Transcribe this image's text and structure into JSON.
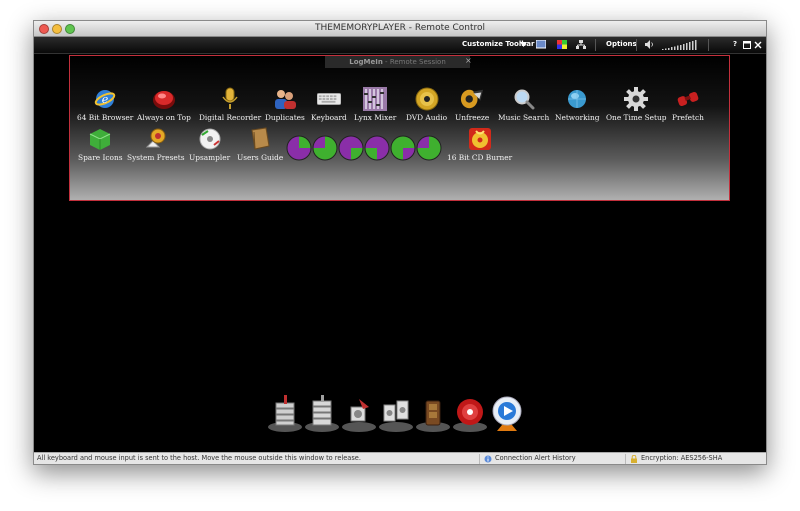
{
  "window": {
    "title": "THEMEMORYPLAYER - Remote Control"
  },
  "toolbar": {
    "customize_label": "Customize Toolbar",
    "options_label": "Options",
    "help_label": "?"
  },
  "remote_session": {
    "banner_brand": "LogMeIn",
    "banner_text": "Remote Session"
  },
  "apps_row1": [
    {
      "label": "64 Bit Browser",
      "icon": "browser-icon"
    },
    {
      "label": "Always on Top",
      "icon": "red-button-icon"
    },
    {
      "label": "Digital Recorder",
      "icon": "microphone-icon"
    },
    {
      "label": "Duplicates",
      "icon": "people-icon"
    },
    {
      "label": "Keyboard",
      "icon": "keyboard-icon"
    },
    {
      "label": "Lynx Mixer",
      "icon": "mixer-icon"
    },
    {
      "label": "DVD Audio",
      "icon": "dvd-icon"
    },
    {
      "label": "Unfreeze",
      "icon": "unfreeze-icon"
    },
    {
      "label": "Music Search",
      "icon": "magnifier-icon"
    },
    {
      "label": "Networking",
      "icon": "globe-icon"
    },
    {
      "label": "One Time Setup",
      "icon": "gear-icon"
    },
    {
      "label": "Prefetch",
      "icon": "binoculars-icon"
    }
  ],
  "apps_row2": [
    {
      "label": "Spare Icons",
      "icon": "green-cube-icon"
    },
    {
      "label": "System Presets",
      "icon": "presets-icon"
    },
    {
      "label": "Upsampler",
      "icon": "upsampler-icon"
    },
    {
      "label": "Users Guide",
      "icon": "book-icon"
    },
    {
      "label": "16 Bit CD Burner",
      "icon": "cd-burner-icon"
    }
  ],
  "status_bar": {
    "message": "All keyboard and mouse input is sent to the host. Move the mouse outside this window to release.",
    "connection_alert": "Connection Alert History",
    "encryption": "Encryption: AES256-SHA"
  },
  "colors": {
    "frame_border": "#c3303c",
    "background": "#000000",
    "status_bar": "#e6e6e6"
  }
}
